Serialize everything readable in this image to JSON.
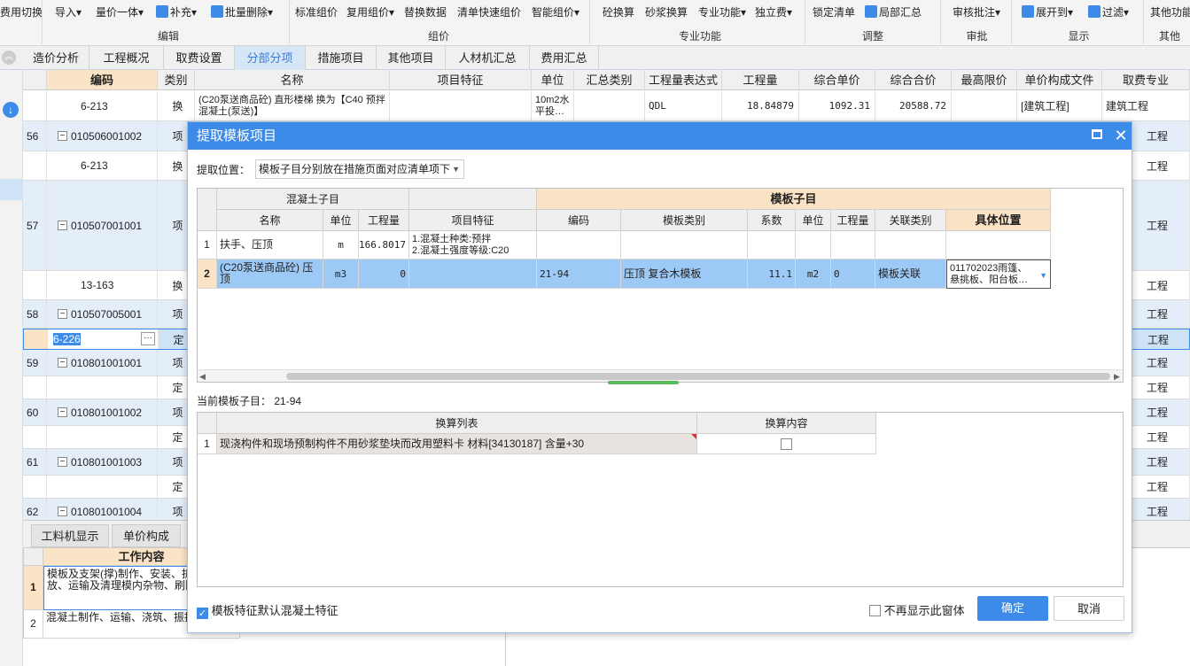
{
  "ribbon": {
    "buttons": [
      "费用切换",
      "导入",
      "量价一体",
      "补充",
      "批量删除",
      "标准组价",
      "复用组价",
      "替换数据",
      "清单快速组价",
      "智能组价",
      "砼换算",
      "砂浆换算",
      "专业功能",
      "独立费",
      "锁定清单",
      "局部汇总",
      "审核批注",
      "展开到",
      "过滤",
      "其他功能"
    ],
    "groups": [
      "编辑",
      "组价",
      "专业功能",
      "调整",
      "审批",
      "显示",
      "其他"
    ],
    "dropdown_arrow": "▾"
  },
  "tabs": [
    "造价分析",
    "工程概况",
    "取费设置",
    "分部分项",
    "措施项目",
    "其他项目",
    "人材机汇总",
    "费用汇总"
  ],
  "active_tab": "分部分项",
  "grid": {
    "headers": [
      "编码",
      "类别",
      "名称",
      "项目特征",
      "单位",
      "汇总类别",
      "工程量表达式",
      "工程量",
      "综合单价",
      "综合合价",
      "最高限价",
      "单价构成文件",
      "取费专业"
    ],
    "rows": [
      {
        "no": "",
        "code": "6-213",
        "type": "换",
        "name": "(C20泵送商品砼) 直形楼梯  换为【C40 预拌混凝土(泵送)】",
        "unit": "10m2水平投…",
        "expr": "QDL",
        "qty": "18.84879",
        "price": "1092.31",
        "total": "20588.72",
        "file": "[建筑工程]",
        "major": "建筑工程"
      },
      {
        "no": "56",
        "code": "010506001002",
        "type": "项",
        "major": "工程"
      },
      {
        "no": "",
        "code": "6-213",
        "type": "换",
        "major": "工程"
      },
      {
        "no": "57",
        "code": "010507001001",
        "type": "项",
        "major": "工程"
      },
      {
        "no": "",
        "code": "13-163",
        "type": "换",
        "major": "工程"
      },
      {
        "no": "58",
        "code": "010507005001",
        "type": "项",
        "major": "工程"
      },
      {
        "no": "",
        "code": "6-226",
        "type": "定",
        "major": "工程"
      },
      {
        "no": "59",
        "code": "010801001001",
        "type": "项",
        "major": "工程"
      },
      {
        "no": "",
        "code": "",
        "type": "定",
        "major": "工程"
      },
      {
        "no": "60",
        "code": "010801001002",
        "type": "项",
        "major": "工程"
      },
      {
        "no": "",
        "code": "",
        "type": "定",
        "major": "工程"
      },
      {
        "no": "61",
        "code": "010801001003",
        "type": "项",
        "major": "工程"
      },
      {
        "no": "",
        "code": "",
        "type": "定",
        "major": "工程"
      },
      {
        "no": "62",
        "code": "010801001004",
        "type": "项",
        "major": "工程"
      }
    ]
  },
  "bottom": {
    "tabs": [
      "工料机显示",
      "单价构成"
    ],
    "header": "工作内容",
    "rows": [
      {
        "no": "1",
        "text": "模板及支架(撑)制作、安装、拆除、堆放、运输及清理模内杂物、刷隔离剂等"
      },
      {
        "no": "2",
        "text": "混凝土制作、运输、浇筑、振捣、养护"
      }
    ]
  },
  "dialog": {
    "title": "提取模板项目",
    "position_label": "提取位置：",
    "position_value": "模板子目分别放在措施页面对应清单项下",
    "group_left": "混凝土子目",
    "group_right": "模板子目",
    "headers": [
      "名称",
      "单位",
      "工程量",
      "项目特征",
      "编码",
      "模板类别",
      "系数",
      "单位",
      "工程量",
      "关联类别",
      "具体位置"
    ],
    "rows": [
      {
        "no": "1",
        "name": "扶手、压顶",
        "unit": "m",
        "qty": "166.8017",
        "feat": "1.混凝土种类:预拌\n2.混凝土强度等级:C20",
        "code": "",
        "cat": "",
        "coef": "",
        "unit2": "",
        "qty2": "",
        "rel": "",
        "pos": ""
      },
      {
        "no": "2",
        "name": "(C20泵送商品砼) 压顶",
        "unit": "m3",
        "qty": "0",
        "feat": "",
        "code": "21-94",
        "cat": "压顶 复合木模板",
        "coef": "11.1",
        "unit2": "m2",
        "qty2": "0",
        "rel": "模板关联",
        "pos": "011702023雨篷、悬挑板、阳台板…"
      }
    ],
    "current_label": "当前模板子目：",
    "current_value": "21-94",
    "conv_headers": [
      "换算列表",
      "换算内容"
    ],
    "conv_rows": [
      {
        "no": "1",
        "text": "现浇构件和现场预制构件不用砂浆垫块而改用塑料卡 材料[34130187] 含量+30"
      }
    ],
    "default_feature_label": "模板特征默认混凝土特征",
    "no_show_label": "不再显示此窗体",
    "ok": "确定",
    "cancel": "取消"
  },
  "colors": {
    "accent": "#3d8be8",
    "selected_row": "#9cc9f5",
    "header_orange": "#fbe4c6"
  }
}
